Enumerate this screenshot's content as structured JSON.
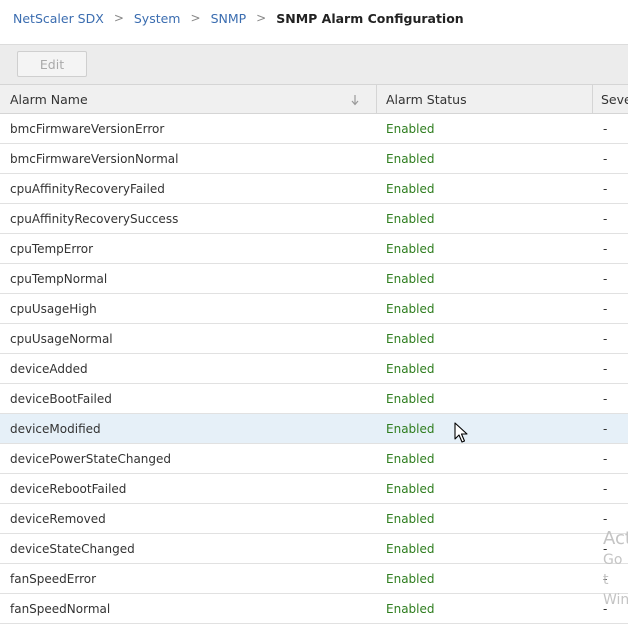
{
  "breadcrumb": {
    "items": [
      "NetScaler SDX",
      "System",
      "SNMP"
    ],
    "current": "SNMP Alarm Configuration",
    "separator": ">"
  },
  "toolbar": {
    "edit_label": "Edit"
  },
  "table": {
    "columns": [
      "Alarm Name",
      "Alarm Status",
      "Seve"
    ],
    "sort_icon": "sort-down-arrow-icon",
    "rows": [
      {
        "name": "bmcFirmwareVersionError",
        "status": "Enabled",
        "severity": "-"
      },
      {
        "name": "bmcFirmwareVersionNormal",
        "status": "Enabled",
        "severity": "-"
      },
      {
        "name": "cpuAffinityRecoveryFailed",
        "status": "Enabled",
        "severity": "-"
      },
      {
        "name": "cpuAffinityRecoverySuccess",
        "status": "Enabled",
        "severity": "-"
      },
      {
        "name": "cpuTempError",
        "status": "Enabled",
        "severity": "-"
      },
      {
        "name": "cpuTempNormal",
        "status": "Enabled",
        "severity": "-"
      },
      {
        "name": "cpuUsageHigh",
        "status": "Enabled",
        "severity": "-"
      },
      {
        "name": "cpuUsageNormal",
        "status": "Enabled",
        "severity": "-"
      },
      {
        "name": "deviceAdded",
        "status": "Enabled",
        "severity": "-"
      },
      {
        "name": "deviceBootFailed",
        "status": "Enabled",
        "severity": "-"
      },
      {
        "name": "deviceModified",
        "status": "Enabled",
        "severity": "-"
      },
      {
        "name": "devicePowerStateChanged",
        "status": "Enabled",
        "severity": "-"
      },
      {
        "name": "deviceRebootFailed",
        "status": "Enabled",
        "severity": "-"
      },
      {
        "name": "deviceRemoved",
        "status": "Enabled",
        "severity": "-"
      },
      {
        "name": "deviceStateChanged",
        "status": "Enabled",
        "severity": "-"
      },
      {
        "name": "fanSpeedError",
        "status": "Enabled",
        "severity": "-"
      },
      {
        "name": "fanSpeedNormal",
        "status": "Enabled",
        "severity": "-"
      }
    ],
    "highlighted_row": 10
  },
  "watermark": {
    "line1": "Act",
    "line2": "Go t",
    "line3": "Win"
  },
  "colors": {
    "link": "#3b6db0",
    "enabled": "#2e7d1e",
    "highlight": "#e6f0f8"
  }
}
